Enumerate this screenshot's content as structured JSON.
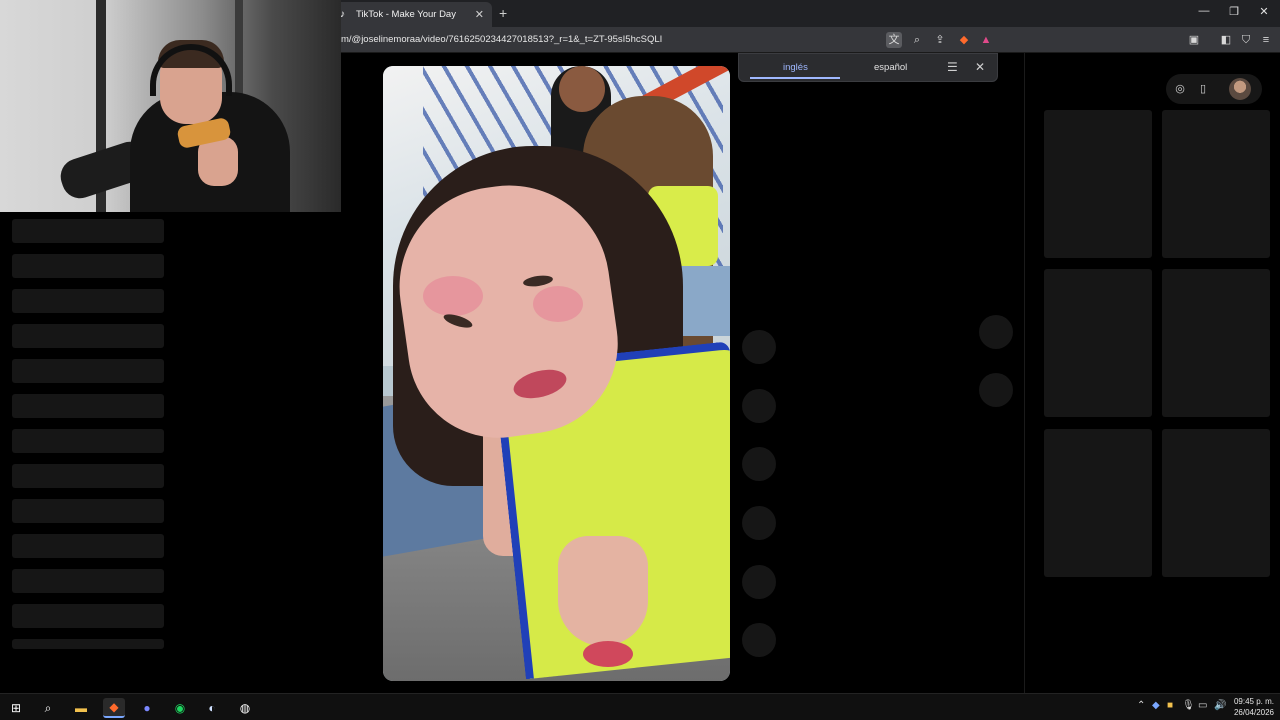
{
  "browser": {
    "tab_title": "TikTok - Make Your Day",
    "url": "m/@joselinemoraa/video/7616250234427018513?_r=1&_t=ZT-95sI5hcSQLI",
    "window_controls": [
      "minimize",
      "restore",
      "close"
    ]
  },
  "translate_popup": {
    "source_lang": "inglés",
    "target_lang": "español"
  },
  "taskbar": {
    "apps": [
      "start",
      "search",
      "file-explorer",
      "brave",
      "discord",
      "spotify",
      "steam",
      "obs"
    ],
    "time": "09:45 p. m.",
    "date": "26/04/2026"
  },
  "colors": {
    "accent": "#9fb8ff",
    "background": "#000000"
  }
}
